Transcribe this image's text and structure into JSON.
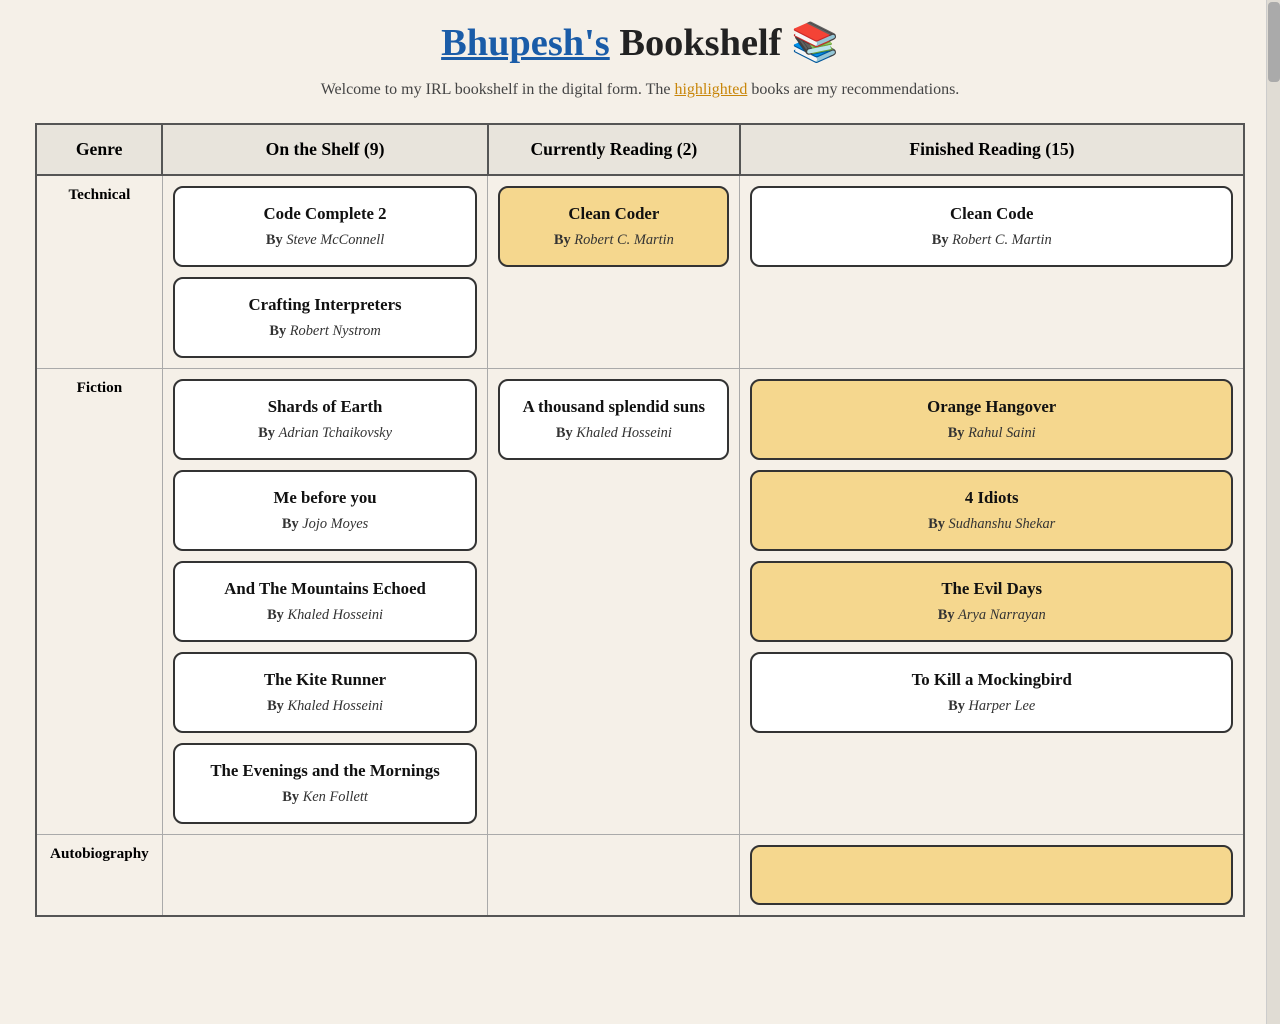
{
  "page": {
    "title_link": "Bhupesh's",
    "title_rest": " Bookshelf 📚",
    "title_href": "#",
    "subtitle_before": "Welcome to my IRL bookshelf in the digital form. The ",
    "subtitle_highlighted": "highlighted",
    "subtitle_after": " books are my recommendations."
  },
  "table": {
    "headers": {
      "genre": "Genre",
      "shelf": "On the Shelf (9)",
      "reading": "Currently Reading (2)",
      "finished": "Finished Reading (15)"
    },
    "rows": [
      {
        "genre": "Technical",
        "shelf_books": [
          {
            "title": "Code Complete 2",
            "author": "Steve McConnell",
            "highlighted": false
          },
          {
            "title": "Crafting Interpreters",
            "author": "Robert Nystrom",
            "highlighted": false
          }
        ],
        "reading_books": [
          {
            "title": "Clean Coder",
            "author": "Robert C. Martin",
            "highlighted": true
          }
        ],
        "finished_books": [
          {
            "title": "Clean Code",
            "author": "Robert C. Martin",
            "highlighted": false
          }
        ]
      },
      {
        "genre": "Fiction",
        "shelf_books": [
          {
            "title": "Shards of Earth",
            "author": "Adrian Tchaikovsky",
            "highlighted": false
          },
          {
            "title": "Me before you",
            "author": "Jojo Moyes",
            "highlighted": false
          },
          {
            "title": "And The Mountains Echoed",
            "author": "Khaled Hosseini",
            "highlighted": false
          },
          {
            "title": "The Kite Runner",
            "author": "Khaled Hosseini",
            "highlighted": false
          },
          {
            "title": "The Evenings and the Mornings",
            "author": "Ken Follett",
            "highlighted": false
          }
        ],
        "reading_books": [
          {
            "title": "A thousand splendid suns",
            "author": "Khaled Hosseini",
            "highlighted": false
          }
        ],
        "finished_books": [
          {
            "title": "Orange Hangover",
            "author": "Rahul Saini",
            "highlighted": true
          },
          {
            "title": "4 Idiots",
            "author": "Sudhanshu Shekar",
            "highlighted": true
          },
          {
            "title": "The Evil Days",
            "author": "Arya Narrayan",
            "highlighted": true
          },
          {
            "title": "To Kill a Mockingbird",
            "author": "Harper Lee",
            "highlighted": false
          }
        ]
      },
      {
        "genre": "Autobiography",
        "shelf_books": [],
        "reading_books": [],
        "finished_books": [
          {
            "title": "",
            "author": "",
            "highlighted": true
          }
        ]
      }
    ]
  }
}
